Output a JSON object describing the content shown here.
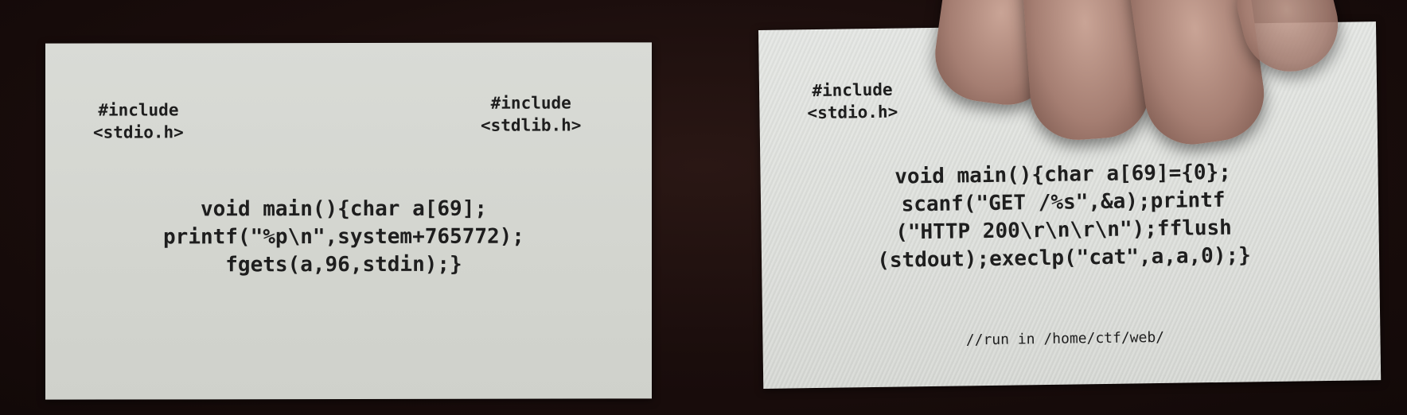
{
  "left_card": {
    "include_1": "#include\n<stdio.h>",
    "include_2": "#include\n<stdlib.h>",
    "code": "void main(){char a[69];\nprintf(\"%p\\n\",system+765772);\nfgets(a,96,stdin);}"
  },
  "right_card": {
    "include_1": "#include\n<stdio.h>",
    "code": "void main(){char a[69]={0};\nscanf(\"GET /%s\",&a);printf\n(\"HTTP 200\\r\\n\\r\\n\");fflush\n(stdout);execlp(\"cat\",a,a,0);}",
    "comment": "//run in /home/ctf/web/"
  }
}
